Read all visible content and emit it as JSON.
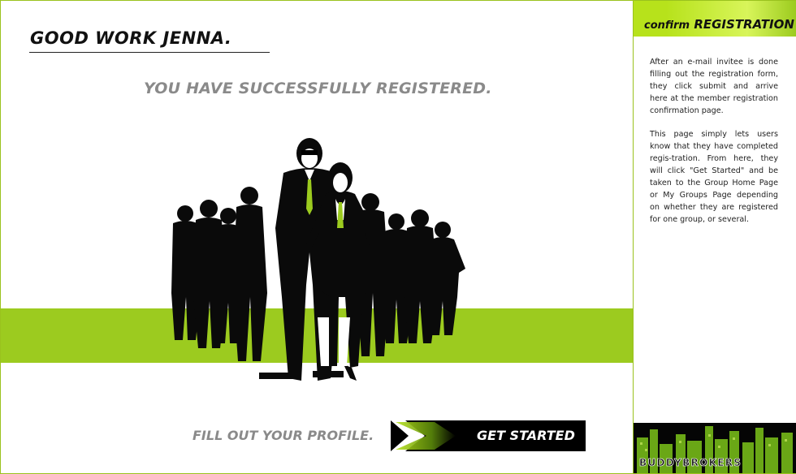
{
  "greeting": "GOOD WORK JENNA.",
  "success_message": "YOU HAVE SUCCESSFULLY REGISTERED.",
  "profile_link": "FILL OUT YOUR PROFILE.",
  "cta_label": "GET STARTED",
  "sidebar": {
    "title_prefix": "confirm",
    "title_main": "REGISTRATION",
    "paragraphs": [
      "After an e-mail invitee is done filling out the registration form, they click submit and arrive here at the member registration confirmation page.",
      "This page simply lets users know that they have completed regis-tration. From here, they will click \"Get Started\" and be taken to the Group Home Page or My Groups Page depending on whether they are registered for one group, or several."
    ]
  },
  "brand": "BUDDYBROKERS",
  "colors": {
    "accent_green": "#9ccb1f",
    "heading_grey": "#8a8a8a",
    "text_dark": "#111111"
  }
}
